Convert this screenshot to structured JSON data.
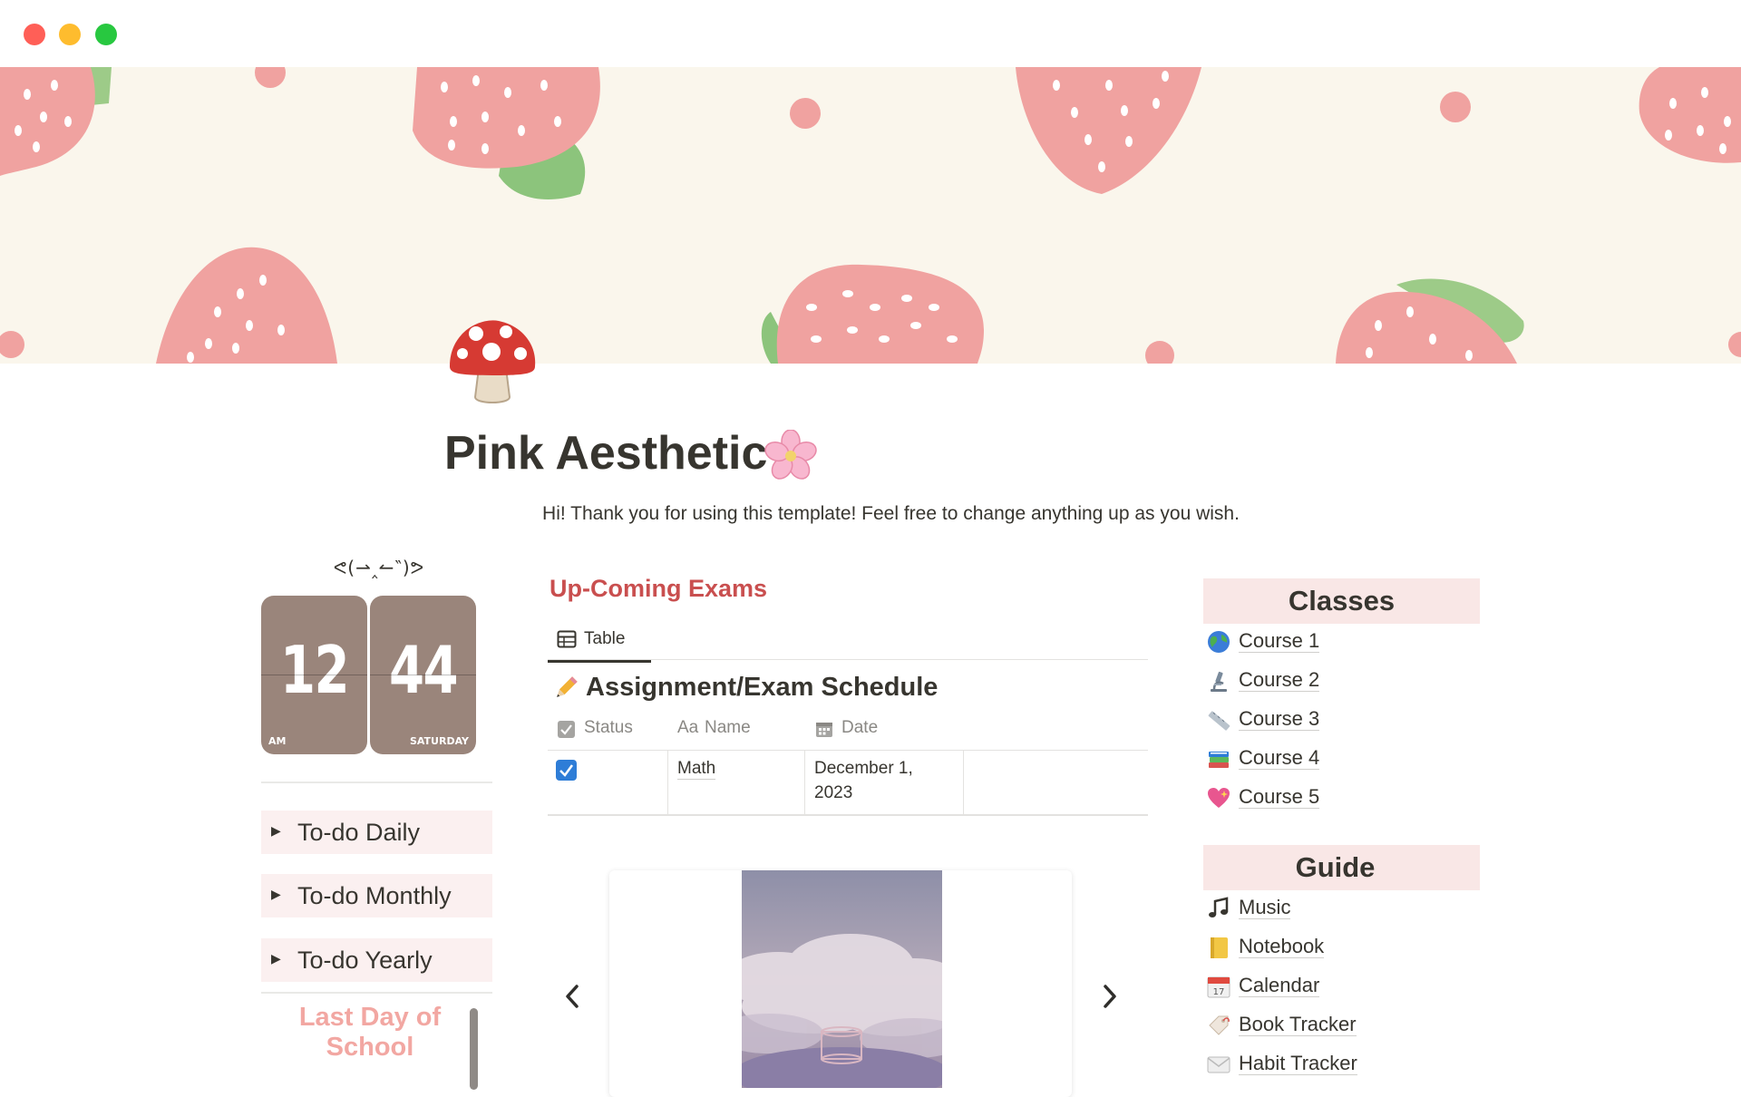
{
  "window": {
    "controls": [
      {
        "name": "close",
        "color": "#ff5f57"
      },
      {
        "name": "minimize",
        "color": "#febc2e"
      },
      {
        "name": "zoom",
        "color": "#28c840"
      }
    ]
  },
  "cover": {
    "background": "#faf6ec",
    "berry_color": "#f0a2a0",
    "leaf_color": "#9dcb88",
    "seed_color": "#ffffff"
  },
  "page": {
    "icon": "mushroom-icon",
    "title": "Pink Aesthetic",
    "title_emoji": "cherry-blossom-icon",
    "intro": "Hi! Thank you for using this template! Feel free to change anything up as you wish."
  },
  "left": {
    "kaomoji": "ᕙ(⇀‸↼‶)ᕗ",
    "clock": {
      "hours": "12",
      "minutes": "44",
      "meridiem": "AM",
      "weekday": "SATURDAY"
    },
    "toggles": [
      {
        "label": "To-do Daily"
      },
      {
        "label": "To-do Monthly"
      },
      {
        "label": "To-do Yearly"
      }
    ],
    "countdown_title": "Last Day of School"
  },
  "middle": {
    "heading": "Up-Coming Exams",
    "view_tab": "Table",
    "database": {
      "title": "Assignment/Exam Schedule",
      "title_icon": "pencil-icon",
      "columns": [
        {
          "label": "Status",
          "icon": "checkbox-icon"
        },
        {
          "label": "Name",
          "icon": "text-icon",
          "prefix": "Aa"
        },
        {
          "label": "Date",
          "icon": "calendar-icon"
        }
      ],
      "rows": [
        {
          "status": true,
          "name": "Math",
          "date_line1": "December 1,",
          "date_line2": "2023"
        }
      ]
    },
    "gallery": {
      "image": "clouds-photo",
      "prev": "chevron-left-icon",
      "next": "chevron-right-icon"
    }
  },
  "right": {
    "classes": {
      "title": "Classes",
      "items": [
        {
          "label": "Course 1",
          "icon": "globe-icon"
        },
        {
          "label": "Course 2",
          "icon": "microscope-icon"
        },
        {
          "label": "Course 3",
          "icon": "ruler-icon"
        },
        {
          "label": "Course 4",
          "icon": "books-icon"
        },
        {
          "label": "Course 5",
          "icon": "heart-icon"
        }
      ]
    },
    "guide": {
      "title": "Guide",
      "items": [
        {
          "label": "Music",
          "icon": "music-notes-icon"
        },
        {
          "label": "Notebook",
          "icon": "notebook-icon"
        },
        {
          "label": "Calendar",
          "icon": "calendar-icon"
        },
        {
          "label": "Book Tracker",
          "icon": "tag-icon"
        },
        {
          "label": "Habit Tracker",
          "icon": "envelope-icon"
        }
      ]
    }
  }
}
